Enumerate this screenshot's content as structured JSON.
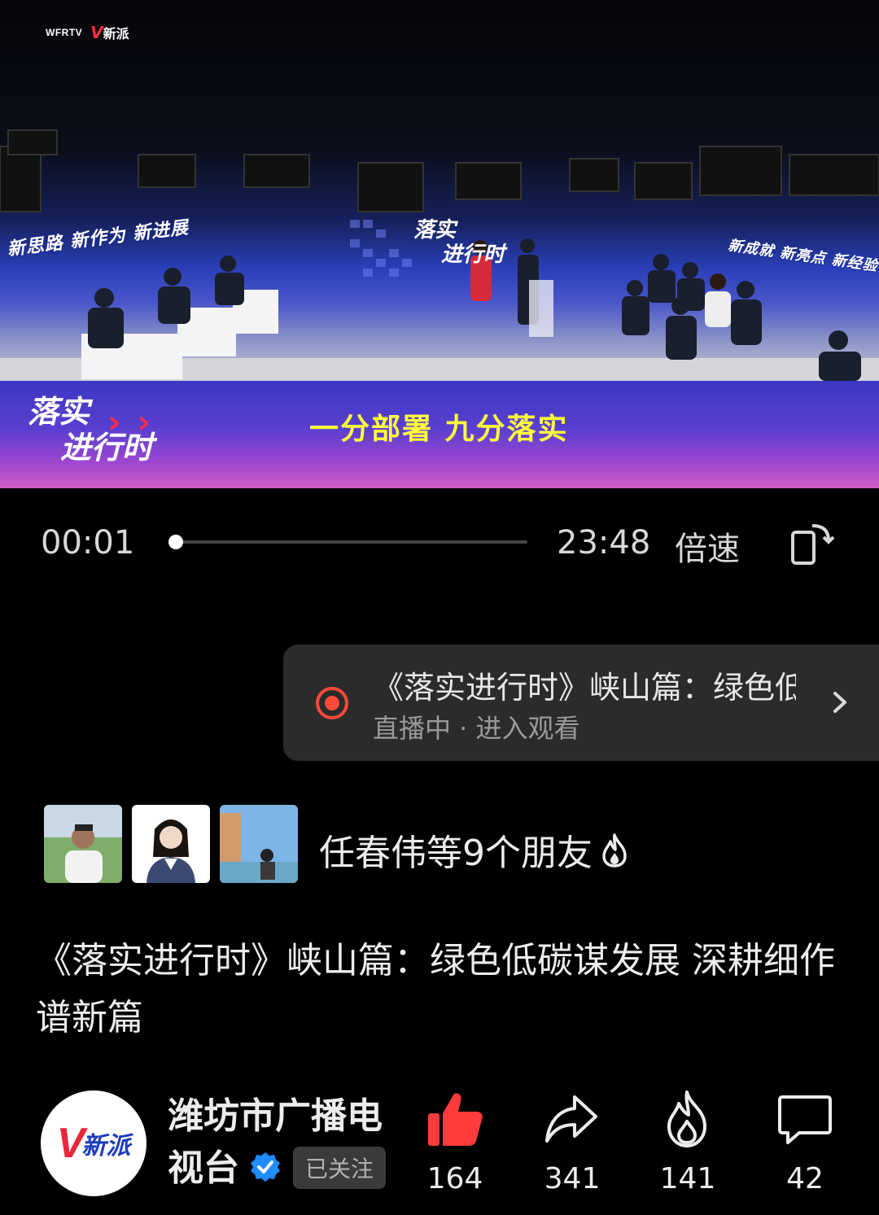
{
  "video": {
    "watermark_wfrtv": "WFRTV",
    "watermark_app": "新派",
    "slogan_left": "新思路 新作为 新进展",
    "slogan_right": "新成就 新亮点 新经验",
    "screen_title_line1": "落实",
    "screen_title_line2": "进行时",
    "logo_line1": "落实",
    "logo_line2": "进行时",
    "caption": "一分部署  九分落实"
  },
  "player": {
    "current_time": "00:01",
    "total_time": "23:48",
    "speed_label": "倍速",
    "progress": 0.001
  },
  "live": {
    "title": "《落实进行时》峡山篇：绿色低碳谋发展",
    "subtitle": "直播中 · 进入观看"
  },
  "friends": {
    "text": "任春伟等9个朋友"
  },
  "title": "《落实进行时》峡山篇：绿色低碳谋发展 深耕细作谱新篇",
  "channel": {
    "name": "潍坊市广播电视台",
    "follow_label": "已关注",
    "logo_text": "新派"
  },
  "actions": {
    "likes": "164",
    "shares": "341",
    "hot": "141",
    "comments": "42"
  },
  "colors": {
    "accent_red": "#ff3b3b",
    "verified_blue": "#1f8cff"
  }
}
